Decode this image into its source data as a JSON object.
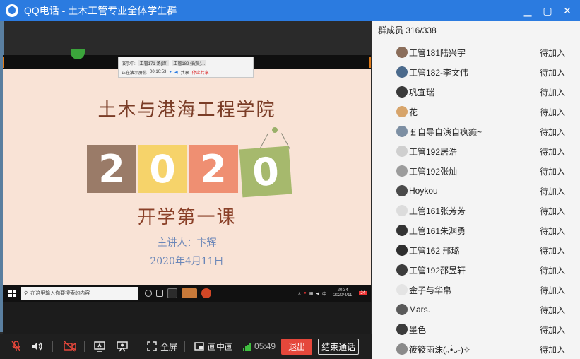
{
  "window": {
    "title": "QQ电话 - 土木工管专业全体学生群",
    "minimize_glyph": "▁",
    "restore_glyph": "▢",
    "close_glyph": "✕"
  },
  "slide": {
    "title": "土木与港海工程学院",
    "year_digits": [
      "2",
      "0",
      "2",
      "0"
    ],
    "year_colors": [
      "#9a7b68",
      "#f6d36a",
      "#ef8f72",
      "#a6b96d"
    ],
    "subtitle": "开学第一课",
    "speaker": "主讲人：卞辉",
    "date": "2020年4月11日"
  },
  "mini_toolbar": {
    "label_top": "演示中:",
    "chip1": "工管171 汤(谭)",
    "chip2": "工管182 张(吴)...",
    "label_bottom": "正在演示屏幕",
    "time": "00:10:53",
    "action": "共享",
    "stop": "停止共享"
  },
  "taskbar": {
    "search_placeholder": "在这里输入你要搜索的内容",
    "time": "20:34",
    "date": "2020/4/11",
    "badge": "24"
  },
  "controls": {
    "fullscreen_label": "全屏",
    "pip_label": "画中画",
    "duration": "05:49",
    "quit_label": "退出",
    "end_label": "结束通话",
    "signal_levels": [
      4,
      6,
      8,
      10
    ]
  },
  "panel": {
    "header": "群成员 316/338",
    "members": [
      {
        "name": "工管181陆兴宇",
        "status": "待加入",
        "avatar_color": "#8a6d5a"
      },
      {
        "name": "工管182-李文伟",
        "status": "待加入",
        "avatar_color": "#4b6a8c"
      },
      {
        "name": "巩宜瑞",
        "status": "待加入",
        "avatar_color": "#3a3a3a"
      },
      {
        "name": "花",
        "status": "待加入",
        "avatar_color": "#d7a46a"
      },
      {
        "name": "￡自导自演自疯癫~",
        "status": "待加入",
        "avatar_color": "#7d8fa3"
      },
      {
        "name": "工管192居浩",
        "status": "待加入",
        "avatar_color": "#cfcfcf"
      },
      {
        "name": "工管192张灿",
        "status": "待加入",
        "avatar_color": "#9c9c9c"
      },
      {
        "name": "Hoykou",
        "status": "待加入",
        "avatar_color": "#4a4a4a"
      },
      {
        "name": "工管161张芳芳",
        "status": "待加入",
        "avatar_color": "#dcdcdc"
      },
      {
        "name": "工管161朱渊勇",
        "status": "待加入",
        "avatar_color": "#333333"
      },
      {
        "name": "工管162  邢璐",
        "status": "待加入",
        "avatar_color": "#2e2e2e"
      },
      {
        "name": "工管192邵昱轩",
        "status": "待加入",
        "avatar_color": "#3c3c3c"
      },
      {
        "name": "金子与华帛",
        "status": "待加入",
        "avatar_color": "#e4e4e4"
      },
      {
        "name": "Mars.",
        "status": "待加入",
        "avatar_color": "#5a5a5a"
      },
      {
        "name": "墨色",
        "status": "待加入",
        "avatar_color": "#3b3b3b"
      },
      {
        "name": "筱筱雨沫(｡•̀ᴗ-)✧",
        "status": "待加入",
        "avatar_color": "#8a8a8a"
      }
    ]
  }
}
